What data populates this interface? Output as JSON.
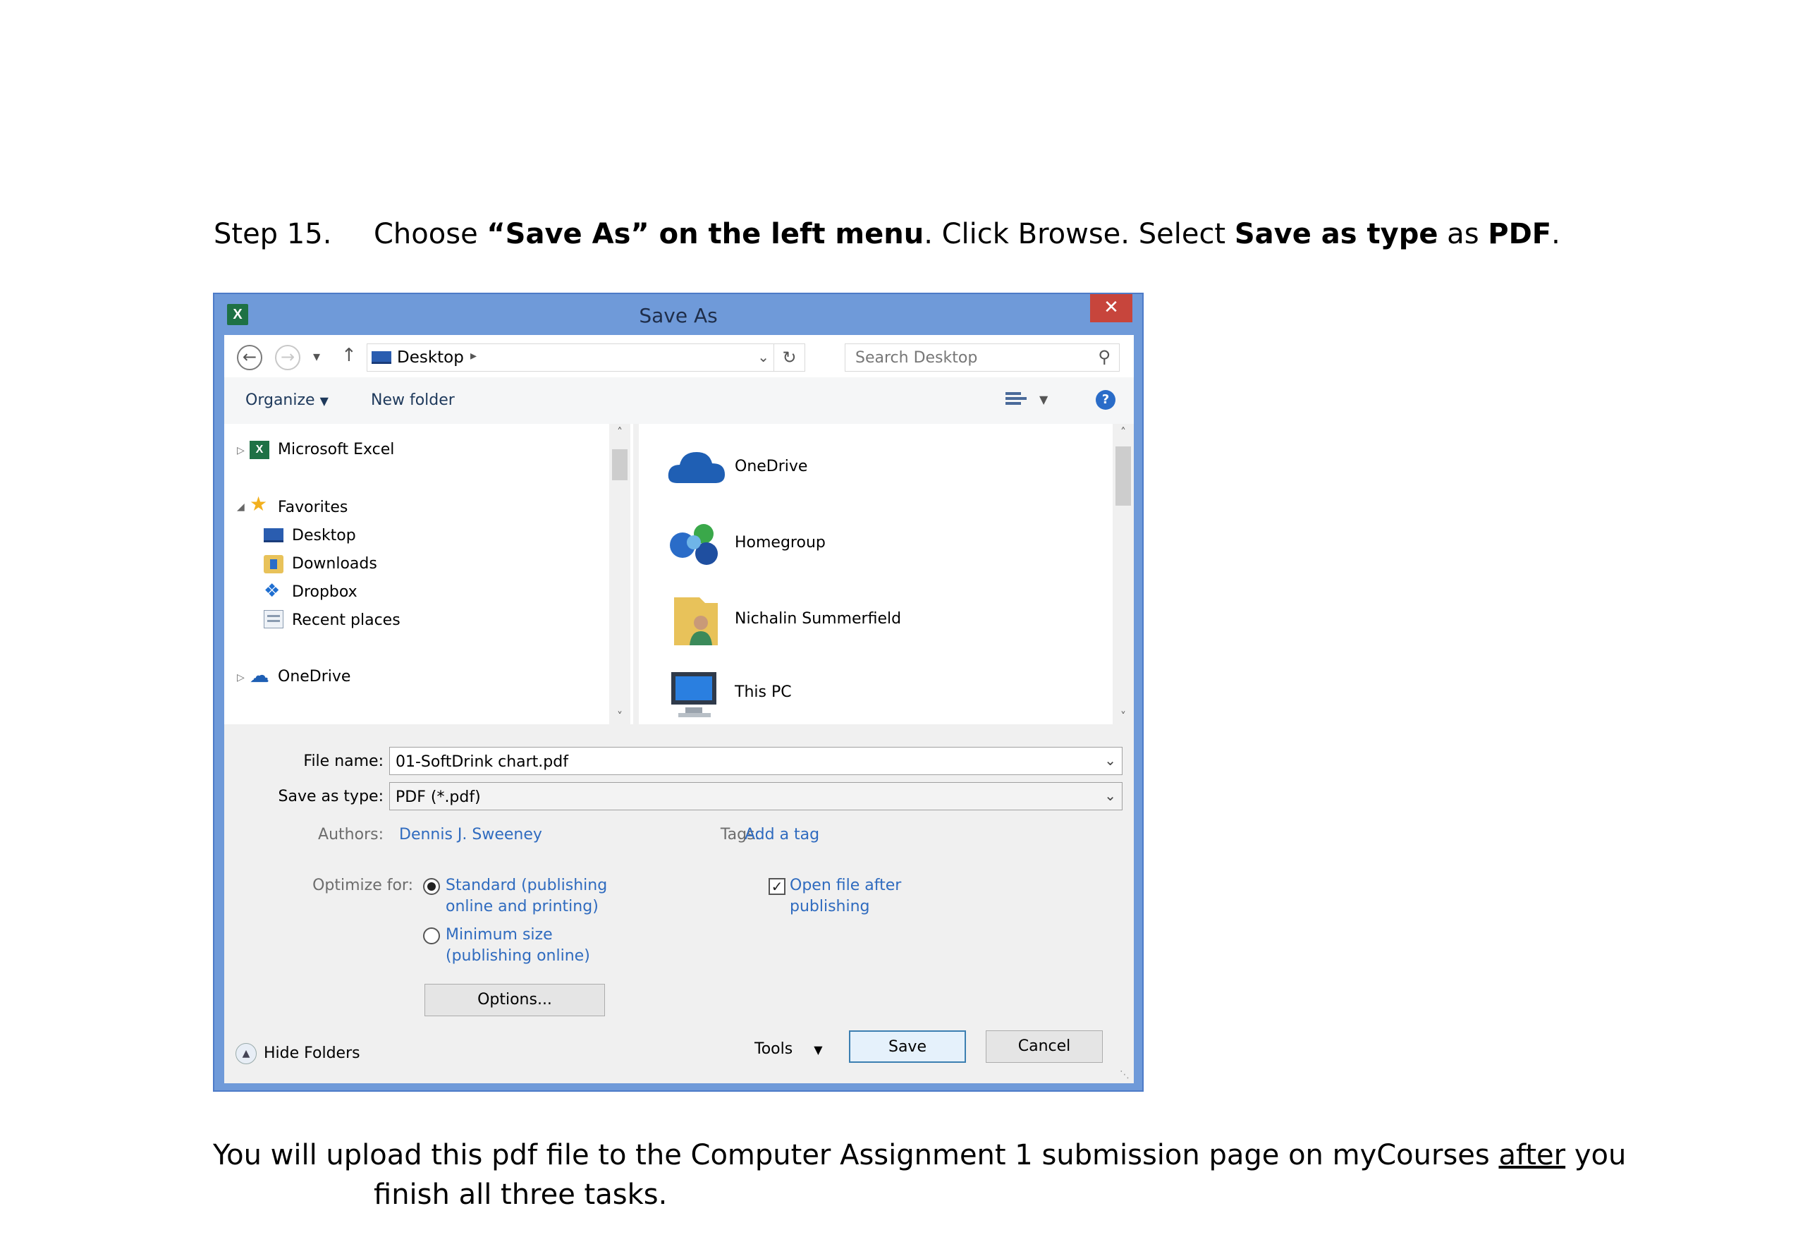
{
  "step": {
    "number": "Step 15.",
    "t1": "Choose ",
    "t2": "“Save As” on the left menu",
    "t3": ". Click Browse. Select ",
    "t4": "Save as type",
    "t5": " as ",
    "t6": "PDF",
    "t7": "."
  },
  "footer": {
    "l1a": "You will upload this pdf file to the Computer Assignment 1 submission page on myCourses ",
    "l1b": "after",
    "l1c": " you",
    "l2": "finish all three tasks."
  },
  "dialog": {
    "title": "Save As",
    "app_icon_glyph": "X",
    "close_glyph": "✕",
    "address": {
      "location": "Desktop"
    },
    "search": {
      "placeholder": "Search Desktop"
    },
    "toolbar": {
      "organize": "Organize",
      "new_folder": "New folder",
      "help_glyph": "?"
    },
    "nav": {
      "excel": "Microsoft Excel",
      "favorites": "Favorites",
      "favorites_items": [
        "Desktop",
        "Downloads",
        "Dropbox",
        "Recent places"
      ],
      "onedrive": "OneDrive"
    },
    "content_items": [
      "OneDrive",
      "Homegroup",
      "Nichalin Summerfield",
      "This PC"
    ],
    "form": {
      "file_name_label": "File name:",
      "file_name_value": "01-SoftDrink chart.pdf",
      "save_type_label": "Save as type:",
      "save_type_value": "PDF (*.pdf)",
      "authors_label": "Authors:",
      "authors_value": "Dennis J. Sweeney",
      "tags_label": "Tags:",
      "tags_value": "Add a tag",
      "optimize_label": "Optimize for:",
      "opt_standard_l1": "Standard (publishing",
      "opt_standard_l2": "online and printing)",
      "opt_min_l1": "Minimum size",
      "opt_min_l2": "(publishing online)",
      "open_after_l1": "Open file after",
      "open_after_l2": "publishing",
      "options_button": "Options...",
      "tools": "Tools",
      "save_button": "Save",
      "cancel_button": "Cancel",
      "hide_folders": "Hide Folders"
    }
  }
}
